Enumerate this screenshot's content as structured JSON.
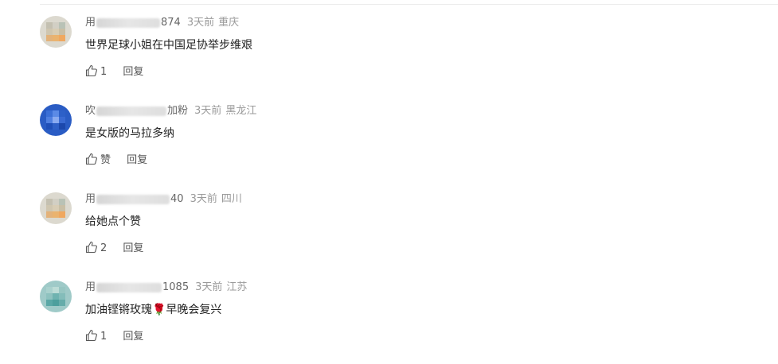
{
  "comments": [
    {
      "username_start": "用",
      "username_end": "874",
      "time": "3天前",
      "location": "重庆",
      "content": "世界足球小姐在中国足协举步维艰",
      "like_label": "1",
      "reply_label": "回复",
      "avatar_colors": [
        "#c9c7b9",
        "#d8b98f",
        "#9fb4a8"
      ]
    },
    {
      "username_start": "吹",
      "username_end": "加粉",
      "time": "3天前",
      "location": "黑龙江",
      "content": "是女版的马拉多纳",
      "like_label": "赞",
      "reply_label": "回复",
      "avatar_colors": [
        "#2f63c9",
        "#5a86de",
        "#1c46a8"
      ]
    },
    {
      "username_start": "用",
      "username_end": "40",
      "time": "3天前",
      "location": "四川",
      "content": "给她点个赞",
      "like_label": "2",
      "reply_label": "回复",
      "avatar_colors": [
        "#c9c7b9",
        "#d8b98f",
        "#9fb4a8"
      ]
    },
    {
      "username_start": "用",
      "username_end": "1085",
      "time": "3天前",
      "location": "江苏",
      "content": "加油铿锵玫瑰🌹早晚会复兴",
      "like_label": "1",
      "reply_label": "回复",
      "avatar_colors": [
        "#8ec5c4",
        "#b2d6cf",
        "#5aa9a8"
      ]
    }
  ]
}
